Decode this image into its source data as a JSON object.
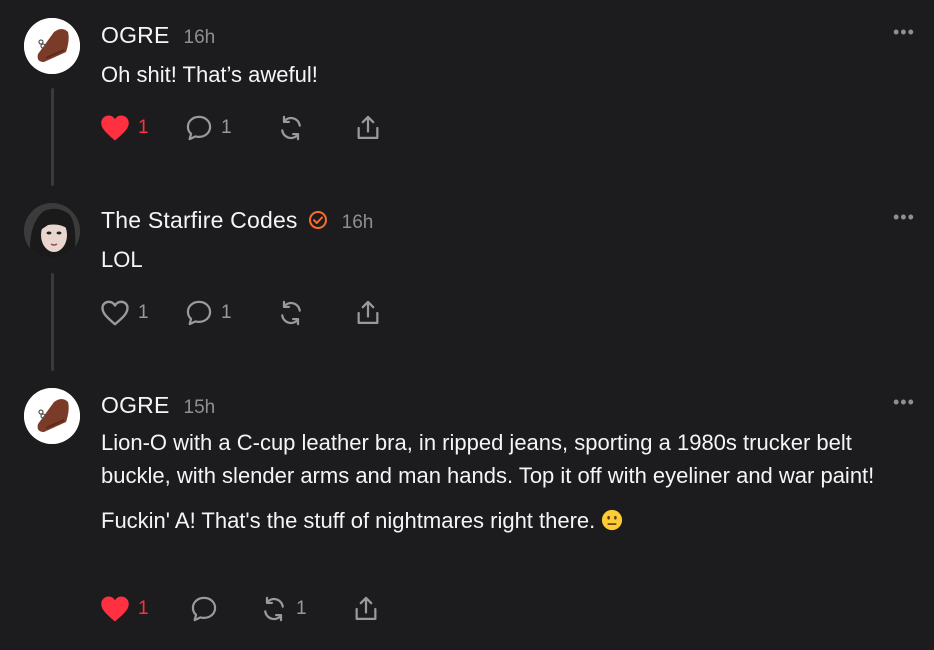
{
  "posts": [
    {
      "author": "OGRE",
      "time": "16h",
      "verified": false,
      "paragraphs": [
        "Oh shit! That’s aweful!"
      ],
      "likes": "1",
      "liked": true,
      "replies": "1",
      "reposts": "",
      "more": "•••"
    },
    {
      "author": "The Starfire Codes",
      "time": "16h",
      "verified": true,
      "paragraphs": [
        "LOL"
      ],
      "likes": "1",
      "liked": false,
      "replies": "1",
      "reposts": "",
      "more": "•••"
    },
    {
      "author": "OGRE",
      "time": "15h",
      "verified": false,
      "paragraphs": [
        "Lion-O with a C-cup leather bra, in ripped jeans, sporting a 1980s trucker belt buckle, with slender arms and man hands. Top it off with eyeliner and war paint!",
        "Fuckin' A! That's the stuff of nightmares right there."
      ],
      "likes": "1",
      "liked": true,
      "replies": "",
      "reposts": "1",
      "more": "•••"
    }
  ],
  "colors": {
    "like": "#ff3040",
    "verified": "#ff6a2b",
    "muted": "#8e8e93",
    "bg": "#1c1c1e"
  },
  "icons": [
    "heart-icon",
    "comment-icon",
    "repost-icon",
    "share-icon",
    "more-icon",
    "verified-icon",
    "neutral-face-emoji"
  ]
}
